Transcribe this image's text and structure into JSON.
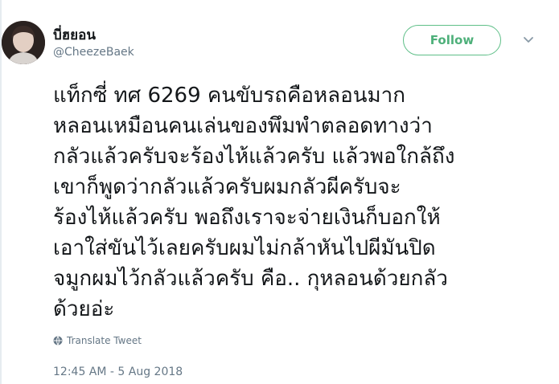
{
  "user": {
    "display_name": "บี่ฮยอน",
    "handle": "@CheezeBaek"
  },
  "follow_label": "Follow",
  "tweet_text": "แท็กซี่ ทศ 6269 คนขับรถคือหลอนมาก\nหลอนเหมือนคนเล่นของพึมพำตลอดทางว่า\nกลัวแล้วครับจะร้องไห้แล้วครับ แล้วพอใกล้ถึง\nเขาก็พูดว่ากลัวแล้วครับผมกลัวผีครับจะ\nร้องไห้แล้วครับ พอถึงเราจะจ่ายเงินก็บอกให้\nเอาใส่ขันไว้เลยครับผมไม่กล้าหันไปผีมันปิด\nจมูกผมไว้กลัวแล้วครับ คือ.. กุหลอนด้วยกลัว\nด้วยอ่ะ",
  "translate_label": "Translate Tweet",
  "timestamp": "12:45 AM - 5 Aug 2018",
  "colors": {
    "follow_accent": "#4eb07a",
    "secondary_text": "#657786",
    "primary_text": "#14171a"
  },
  "icons": {
    "caret": "chevron-down-icon",
    "translate": "globe-icon"
  }
}
